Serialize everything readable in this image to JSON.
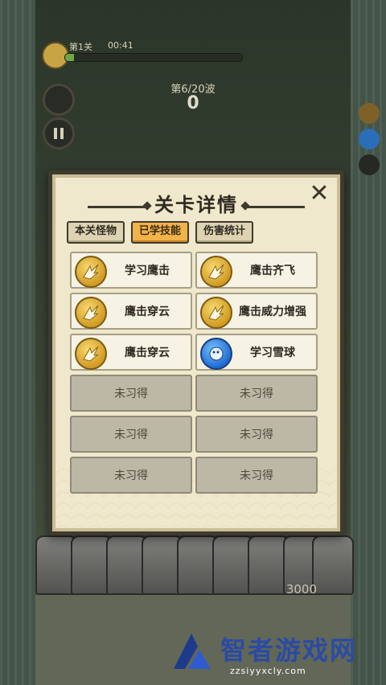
{
  "hud": {
    "level": "第1关",
    "time": "00:41",
    "progress": 0.05,
    "wave": "第6/20波",
    "score": "0",
    "wall_hp": "3000"
  },
  "modal": {
    "title": "关卡详情",
    "close_glyph": "✕",
    "tabs": [
      {
        "label": "本关怪物",
        "active": false
      },
      {
        "label": "已学技能",
        "active": true
      },
      {
        "label": "伤害统计",
        "active": false
      }
    ],
    "skills": [
      {
        "label": "学习鹰击",
        "icon": "eagle-icon",
        "learned": true
      },
      {
        "label": "鹰击齐飞",
        "icon": "eagle-icon",
        "learned": true
      },
      {
        "label": "鹰击穿云",
        "icon": "eagle-icon",
        "learned": true
      },
      {
        "label": "鹰击威力增强",
        "icon": "eagle-icon",
        "learned": true
      },
      {
        "label": "鹰击穿云",
        "icon": "eagle-icon",
        "learned": true
      },
      {
        "label": "学习雪球",
        "icon": "snowball-icon",
        "learned": true
      },
      {
        "label": "未习得",
        "learned": false
      },
      {
        "label": "未习得",
        "learned": false
      },
      {
        "label": "未习得",
        "learned": false
      },
      {
        "label": "未习得",
        "learned": false
      },
      {
        "label": "未习得",
        "learned": false
      },
      {
        "label": "未习得",
        "learned": false
      }
    ]
  },
  "watermark": {
    "text": "智者游戏网",
    "url": "zzsiyyxcly.com"
  },
  "colors": {
    "panel_bg": "#f0e8cc",
    "tab_active": "#f2b34a",
    "gold_icon": "#d19b23",
    "blue_icon": "#1f6ad0",
    "empty_cell": "#bdb8a6"
  }
}
